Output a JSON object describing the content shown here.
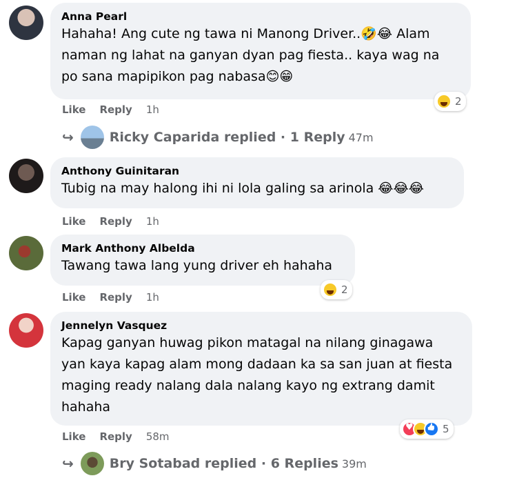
{
  "actions": {
    "like": "Like",
    "reply": "Reply"
  },
  "comments": [
    {
      "author": "Anna Pearl",
      "text": "Hahaha! Ang cute ng tawa ni Manong Driver..🤣😂 Alam naman ng lahat na ganyan dyan pag fiesta.. kaya wag na po sana mapipikon pag nabasa😊😁",
      "time": "1h",
      "reactions": {
        "icons": [
          "haha-icon"
        ],
        "count": "2"
      },
      "replies": {
        "name": "Ricky Caparida",
        "label": "replied · 1 Reply",
        "time": "47m"
      },
      "avatar_color": "#3b4a5c"
    },
    {
      "author": "Anthony Guinitaran",
      "text": "Tubig na may halong ihi ni lola galing sa arinola 😂😂😂",
      "time": "1h",
      "avatar_color": "#2b2222"
    },
    {
      "author": "Mark Anthony Albelda",
      "text": "Tawang tawa lang yung driver eh hahaha",
      "time": "1h",
      "reactions": {
        "icons": [
          "haha-icon"
        ],
        "count": "2"
      },
      "avatar_color": "#5a6b3a"
    },
    {
      "author": "Jennelyn Vasquez",
      "text": "Kapag ganyan huwag pikon matagal na nilang ginagawa yan kaya kapag alam mong dadaan ka sa san juan at fiesta maging ready nalang dala nalang kayo ng extrang damit hahaha",
      "time": "58m",
      "reactions": {
        "icons": [
          "love-icon",
          "haha-icon",
          "like-icon"
        ],
        "count": "5"
      },
      "replies": {
        "name": "Bry Sotabad",
        "label": "replied · 6 Replies",
        "time": "39m"
      },
      "avatar_color": "#c8323a"
    }
  ]
}
